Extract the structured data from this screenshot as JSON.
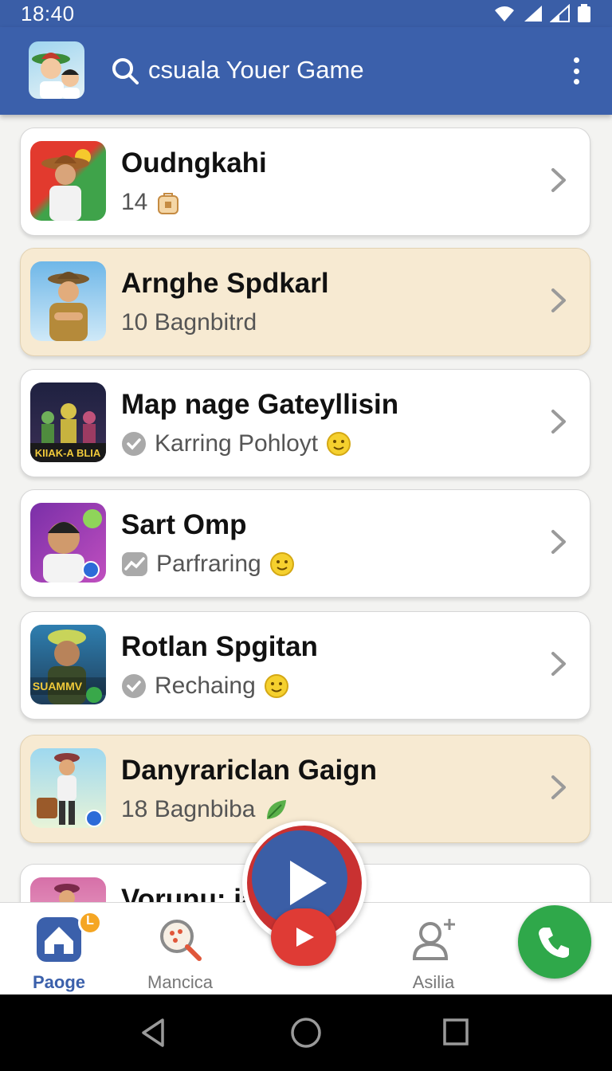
{
  "status": {
    "time": "18:40",
    "icons": [
      "wifi-icon",
      "signal-icon",
      "signal-weak-icon",
      "battery-icon"
    ]
  },
  "app_bar": {
    "title": "csuala Youer Game",
    "icons": [
      "avatar",
      "search-icon",
      "more-vert-icon"
    ]
  },
  "games": [
    {
      "title": "Oudngkahi",
      "subtitle": "14",
      "sub_icon": "bag-icon",
      "highlighted": false
    },
    {
      "title": "Arnghe Spdkarl",
      "subtitle": "10 Bagnbitrd",
      "highlighted": true
    },
    {
      "title": "Map nage Gateyllisin",
      "subtitle": "Karring Pohloyt",
      "sub_icon": "check-badge-icon",
      "highlighted": false,
      "thumb_text": "KIIAK-A BLIA"
    },
    {
      "title": "Sart Omp",
      "subtitle": "Parfraring",
      "sub_icon": "trend-badge-icon",
      "highlighted": false
    },
    {
      "title": "Rotlan Spgitan",
      "subtitle": "Rechaing",
      "sub_icon": "check-badge-icon",
      "highlighted": false,
      "thumb_text": "SUAMMV"
    },
    {
      "title": "Danyrariclan Gaign",
      "subtitle": "18 Bagnbiba",
      "sub_icon": "leaf-icon",
      "highlighted": true
    },
    {
      "title": "Vorunu: ia",
      "subtitle": "",
      "highlighted": false
    }
  ],
  "bottom_nav": [
    {
      "label": "Paoge",
      "icon": "home-icon",
      "active": true,
      "badge": "L"
    },
    {
      "label": "Mancica",
      "icon": "search-explore-icon",
      "active": false
    },
    {
      "label": "Asilia",
      "icon": "add-person-icon",
      "active": false
    }
  ],
  "colors": {
    "primary": "#3b60ab",
    "highlight_card": "#f7ead2",
    "fab_red": "#df3b35",
    "fab_green": "#2fa84a"
  }
}
